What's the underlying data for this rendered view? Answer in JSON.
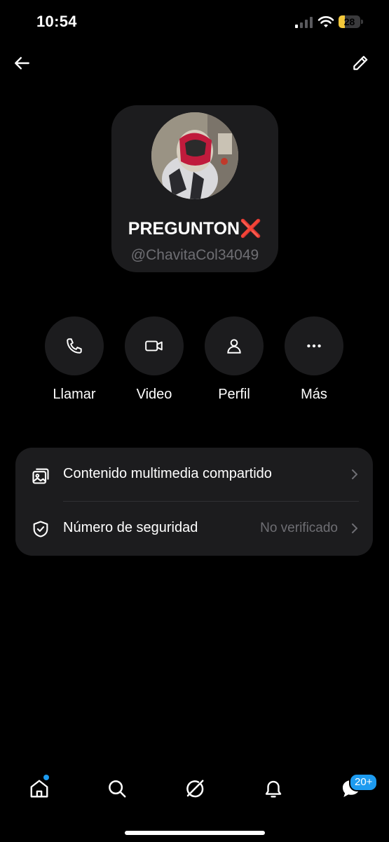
{
  "status_bar": {
    "time": "10:54",
    "battery_level": "28"
  },
  "profile": {
    "name": "PREGUNTON❌",
    "handle": "@ChavitaCol34049"
  },
  "actions": [
    {
      "label": "Llamar",
      "icon": "phone-icon"
    },
    {
      "label": "Video",
      "icon": "video-icon"
    },
    {
      "label": "Perfil",
      "icon": "person-icon"
    },
    {
      "label": "Más",
      "icon": "more-icon"
    }
  ],
  "info": {
    "media_label": "Contenido multimedia compartido",
    "security_label": "Número de seguridad",
    "security_value": "No verificado"
  },
  "tabbar": {
    "items": [
      "home-icon",
      "search-icon",
      "grok-icon",
      "notifications-icon",
      "messages-icon"
    ],
    "messages_badge": "20+"
  },
  "colors": {
    "background": "#000000",
    "surface": "#1c1c1e",
    "secondary_text": "#6e6e73",
    "accent": "#1d9bf0",
    "battery": "#f4c83a"
  }
}
